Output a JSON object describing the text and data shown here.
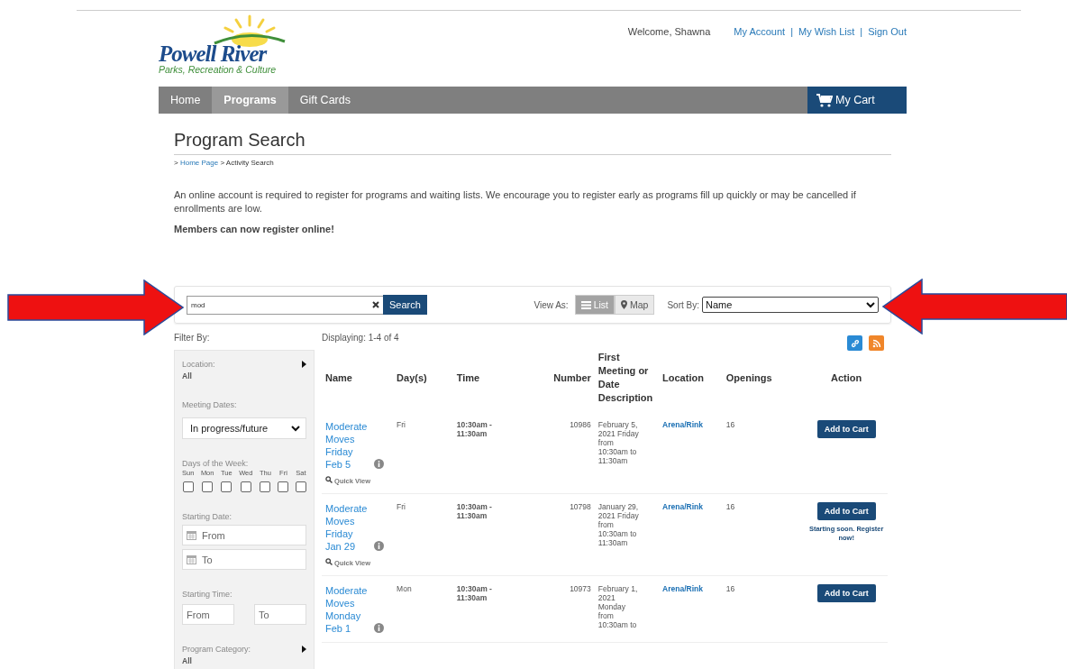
{
  "header": {
    "logo": {
      "title": "Powell River",
      "subtitle": "Parks, Recreation & Culture"
    },
    "welcome": "Welcome, Shawna",
    "account_links": [
      "My Account",
      "My Wish List",
      "Sign Out"
    ],
    "link_separator": "|"
  },
  "nav": {
    "items": [
      {
        "label": "Home",
        "selected": false
      },
      {
        "label": "Programs",
        "selected": true
      },
      {
        "label": "Gift Cards",
        "selected": false
      }
    ],
    "cart": "My Cart"
  },
  "page_title": "Program Search",
  "breadcrumb": {
    "lead": ">",
    "link": "Home Page",
    "rest": "> Activity Search"
  },
  "intro": "An online account is required to register for programs and waiting lists. We encourage you to register early as programs fill up quickly or may be cancelled if enrollments are low.",
  "members_note": "Members can now register online!",
  "search": {
    "value": "mod",
    "button": "Search"
  },
  "view_as": {
    "label": "View As:",
    "options": [
      {
        "label": "List",
        "selected": true
      },
      {
        "label": "Map",
        "selected": false
      }
    ]
  },
  "sort_by": {
    "label": "Sort By:",
    "value": "Name"
  },
  "filter_label": "Filter By:",
  "displaying": "Displaying: 1-4 of 4",
  "filters": [
    {
      "kind": "expander",
      "label": "Location:",
      "value": "All"
    },
    {
      "kind": "select",
      "label": "Meeting Dates:",
      "value": "In progress/future"
    },
    {
      "kind": "days",
      "label": "Days of the Week:",
      "days": [
        {
          "label": "Sun",
          "checked": false
        },
        {
          "label": "Mon",
          "checked": false
        },
        {
          "label": "Tue",
          "checked": false
        },
        {
          "label": "Wed",
          "checked": false
        },
        {
          "label": "Thu",
          "checked": false
        },
        {
          "label": "Fri",
          "checked": false
        },
        {
          "label": "Sat",
          "checked": false
        }
      ]
    },
    {
      "kind": "date_range",
      "label": "Starting Date:",
      "fields": [
        {
          "placeholder": "From"
        },
        {
          "placeholder": "To"
        }
      ]
    },
    {
      "kind": "time_range",
      "label": "Starting Time:",
      "fields": [
        {
          "placeholder": "From"
        },
        {
          "placeholder": "To"
        }
      ]
    },
    {
      "kind": "expander",
      "label": "Program Category:",
      "value": "All"
    }
  ],
  "table": {
    "columns": [
      "Name",
      "Day(s)",
      "Time",
      "Number",
      "First Meeting or Date Description",
      "Location",
      "Openings",
      "Action"
    ],
    "rows": [
      {
        "name": "Moderate Moves Friday Feb 5",
        "days": "Fri",
        "time": "10:30am - 11:30am",
        "number": "10986",
        "first_meeting": "February 5, 2021 Friday from 10:30am to 11:30am",
        "location": "Arena/Rink",
        "openings": "16",
        "action": "Add to Cart",
        "quick_view": "Quick View"
      },
      {
        "name": "Moderate Moves Friday Jan 29",
        "days": "Fri",
        "time": "10:30am - 11:30am",
        "number": "10798",
        "first_meeting": "January 29, 2021 Friday from 10:30am to 11:30am",
        "location": "Arena/Rink",
        "openings": "16",
        "action": "Add to Cart",
        "note": "Starting soon. Register now!",
        "quick_view": "Quick View"
      },
      {
        "name": "Moderate Moves Monday Feb 1",
        "days": "Mon",
        "time": "10:30am - 11:30am",
        "number": "10973",
        "first_meeting": "February 1, 2021 Monday from 10:30am to",
        "location": "Arena/Rink",
        "openings": "16",
        "action": "Add to Cart"
      }
    ]
  }
}
